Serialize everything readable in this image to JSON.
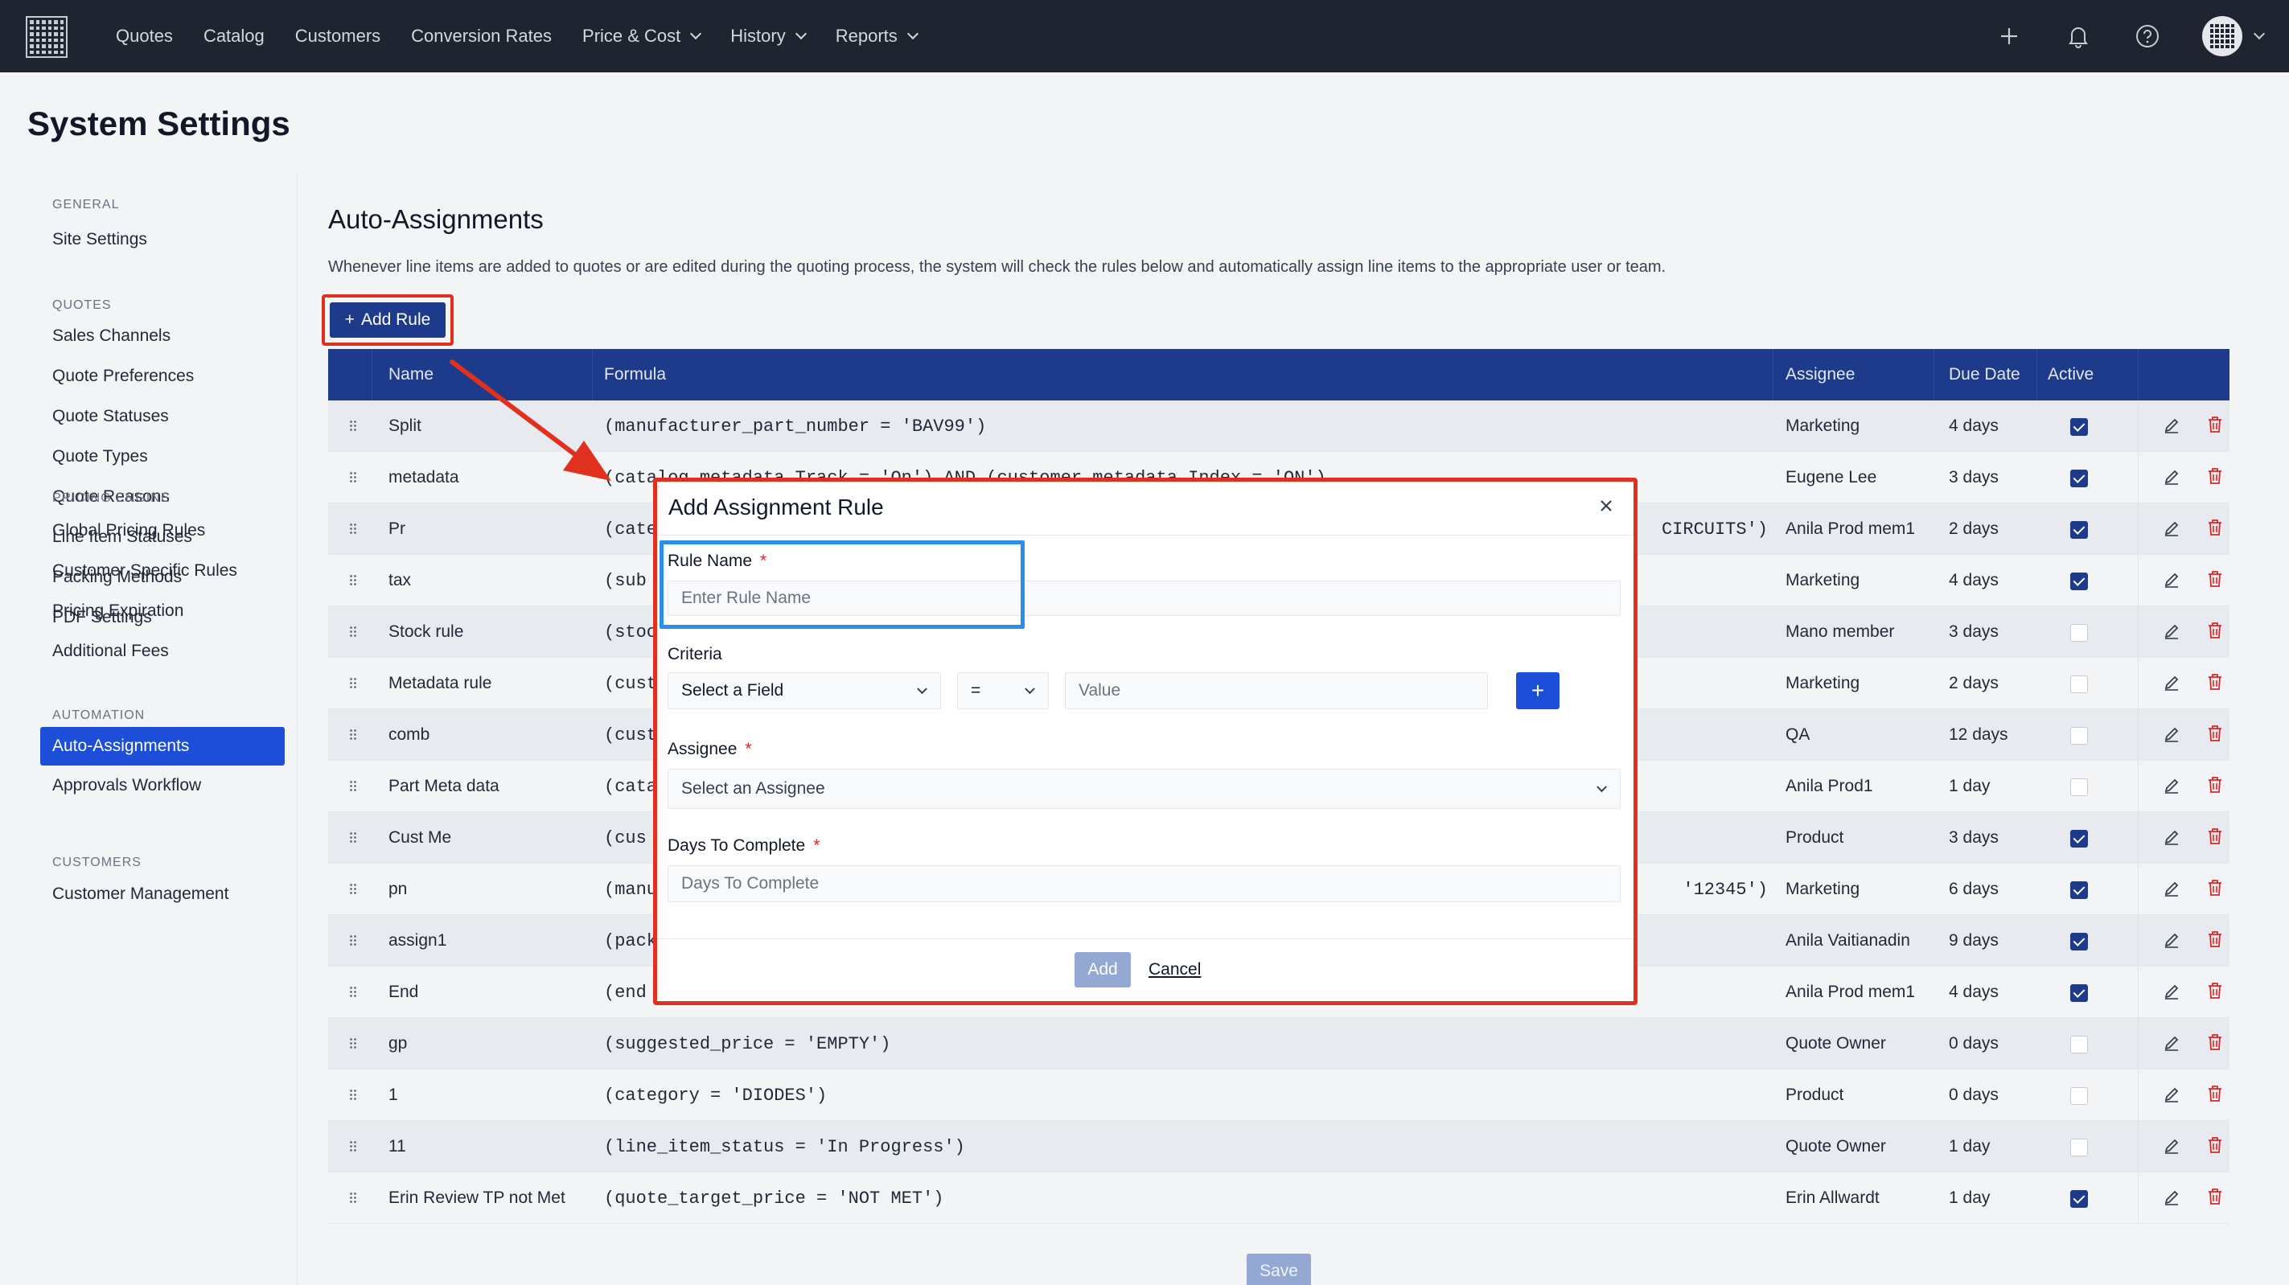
{
  "nav": {
    "items": [
      {
        "label": "Quotes",
        "dropdown": false
      },
      {
        "label": "Catalog",
        "dropdown": false
      },
      {
        "label": "Customers",
        "dropdown": false
      },
      {
        "label": "Conversion Rates",
        "dropdown": false
      },
      {
        "label": "Price & Cost",
        "dropdown": true
      },
      {
        "label": "History",
        "dropdown": true
      },
      {
        "label": "Reports",
        "dropdown": true
      }
    ],
    "icons": [
      "plus-icon",
      "bell-icon",
      "help-icon",
      "avatar-grid-icon"
    ]
  },
  "page": {
    "title": "System Settings"
  },
  "sidebar": {
    "groups": [
      {
        "label": "GENERAL",
        "items": [
          "Site Settings"
        ]
      },
      {
        "label": "QUOTES",
        "items": [
          "Sales Channels",
          "Quote Preferences",
          "Quote Statuses",
          "Quote Types",
          "Quote Reasons",
          "Line Item Statuses",
          "Packing Methods",
          "PDF Settings"
        ]
      },
      {
        "label": "PRICING ENGINE",
        "items": [
          "Global Pricing Rules",
          "Customer Specific Rules",
          "Pricing Expiration",
          "Additional Fees"
        ]
      },
      {
        "label": "AUTOMATION",
        "items": [
          "Auto-Assignments",
          "Approvals Workflow"
        ]
      },
      {
        "label": "CUSTOMERS",
        "items": [
          "Customer Management"
        ]
      }
    ],
    "active": "Auto-Assignments"
  },
  "section": {
    "title": "Auto-Assignments",
    "description": "Whenever line items are added to quotes or are edited during the quoting process, the system will check the rules below and automatically assign line items to the appropriate user or team.",
    "add_rule_label": "Add Rule",
    "save_label": "Save"
  },
  "table": {
    "headers": {
      "name": "Name",
      "formula": "Formula",
      "assignee": "Assignee",
      "due": "Due Date",
      "active": "Active"
    },
    "rows": [
      {
        "name": "Split",
        "formula": "(manufacturer_part_number = 'BAV99')",
        "assignee": "Marketing",
        "due": "4 days",
        "active": true
      },
      {
        "name": "metadata",
        "formula": "(catalog_metadata_Track = 'On') AND (customer_metadata_Index = 'ON')",
        "assignee": "Eugene Lee",
        "due": "3 days",
        "active": true
      },
      {
        "name": "Pr",
        "formula": "(cate",
        "formula_tail": "CIRCUITS')",
        "assignee": "Anila Prod mem1",
        "due": "2 days",
        "active": true
      },
      {
        "name": "tax",
        "formula": "(sub",
        "assignee": "Marketing",
        "due": "4 days",
        "active": true
      },
      {
        "name": "Stock rule",
        "formula": "(stoc",
        "assignee": "Mano member",
        "due": "3 days",
        "active": false
      },
      {
        "name": "Metadata rule",
        "formula": "(cust",
        "assignee": "Marketing",
        "due": "2 days",
        "active": false
      },
      {
        "name": "comb",
        "formula": "(cust",
        "assignee": "QA",
        "due": "12 days",
        "active": false
      },
      {
        "name": "Part Meta data",
        "formula": "(cata",
        "assignee": "Anila Prod1",
        "due": "1 day",
        "active": false
      },
      {
        "name": "Cust Me",
        "formula": "(cus",
        "assignee": "Product",
        "due": "3 days",
        "active": true
      },
      {
        "name": "pn",
        "formula": "(manu",
        "formula_tail": "'12345')",
        "assignee": "Marketing",
        "due": "6 days",
        "active": true
      },
      {
        "name": "assign1",
        "formula": "(pack",
        "assignee": "Anila Vaitianadin",
        "due": "9 days",
        "active": true
      },
      {
        "name": "End",
        "formula": "(end",
        "assignee": "Anila Prod mem1",
        "due": "4 days",
        "active": true
      },
      {
        "name": "gp",
        "formula": "(suggested_price = 'EMPTY')",
        "assignee": "Quote Owner",
        "due": "0 days",
        "active": false
      },
      {
        "name": "1",
        "formula": "(category = 'DIODES')",
        "assignee": "Product",
        "due": "0 days",
        "active": false
      },
      {
        "name": "11",
        "formula": "(line_item_status = 'In Progress')",
        "assignee": "Quote Owner",
        "due": "1 day",
        "active": false
      },
      {
        "name": "Erin Review TP not Met",
        "formula": "(quote_target_price = 'NOT MET')",
        "assignee": "Erin Allwardt",
        "due": "1 day",
        "active": true
      }
    ]
  },
  "modal": {
    "title": "Add Assignment Rule",
    "rule_name_label": "Rule Name",
    "rule_name_placeholder": "Enter Rule Name",
    "criteria_label": "Criteria",
    "field_select": "Select a Field",
    "operator": "=",
    "value_placeholder": "Value",
    "assignee_label": "Assignee",
    "assignee_select": "Select an Assignee",
    "days_label": "Days To Complete",
    "days_placeholder": "Days To Complete",
    "add_label": "Add",
    "cancel_label": "Cancel",
    "required_mark": "*"
  },
  "colors": {
    "nav_bg": "#1e2530",
    "primary": "#1e3a8a",
    "accent": "#1d4ed8",
    "annotation_red": "#e0301e",
    "annotation_blue": "#2b8fe8"
  }
}
